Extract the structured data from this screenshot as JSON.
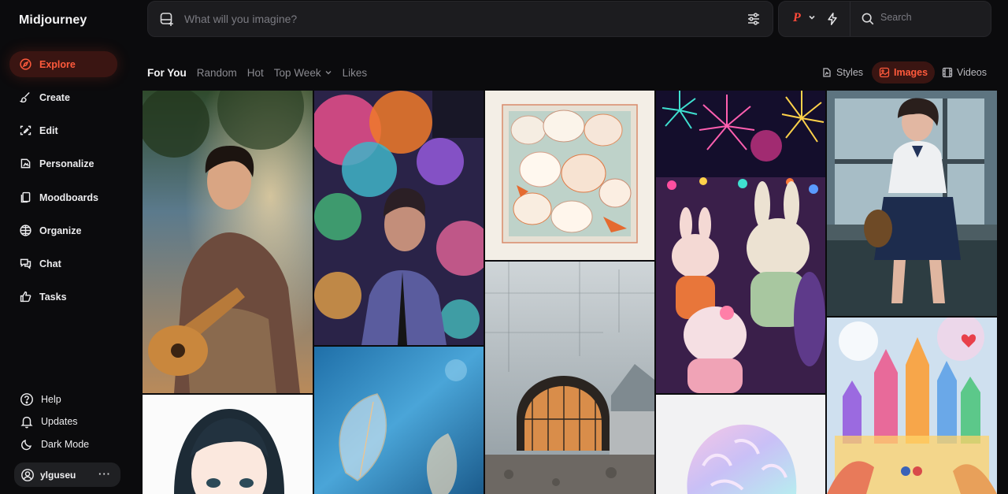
{
  "app": {
    "name": "Midjourney"
  },
  "sidebar": {
    "items": [
      {
        "label": "Explore",
        "icon": "compass-icon",
        "active": true
      },
      {
        "label": "Create",
        "icon": "brush-icon",
        "active": false
      },
      {
        "label": "Edit",
        "icon": "edit-frame-icon",
        "active": false
      },
      {
        "label": "Personalize",
        "icon": "personalize-icon",
        "active": false
      },
      {
        "label": "Moodboards",
        "icon": "moodboard-icon",
        "active": false
      },
      {
        "label": "Organize",
        "icon": "grid-icon",
        "active": false
      },
      {
        "label": "Chat",
        "icon": "chat-icon",
        "active": false
      },
      {
        "label": "Tasks",
        "icon": "thumbs-up-icon",
        "active": false
      }
    ],
    "bottom": [
      {
        "label": "Help",
        "icon": "help-icon"
      },
      {
        "label": "Updates",
        "icon": "bell-icon"
      },
      {
        "label": "Dark Mode",
        "icon": "moon-icon"
      }
    ],
    "user": {
      "name": "ylguseu",
      "more": "···"
    }
  },
  "topbar": {
    "prompt_placeholder": "What will you imagine?",
    "personalize_letter": "P",
    "search_placeholder": "Search"
  },
  "tabs": [
    {
      "label": "For You",
      "active": true
    },
    {
      "label": "Random",
      "active": false
    },
    {
      "label": "Hot",
      "active": false
    },
    {
      "label": "Top Week",
      "active": false,
      "dropdown": true
    },
    {
      "label": "Likes",
      "active": false
    }
  ],
  "view_toggles": [
    {
      "label": "Styles",
      "icon": "styles-icon",
      "active": false
    },
    {
      "label": "Images",
      "icon": "image-icon",
      "active": true
    },
    {
      "label": "Videos",
      "icon": "film-icon",
      "active": false
    }
  ],
  "colors": {
    "accent": "#ff5a3c",
    "accent_bg": "#3a1512",
    "background": "#0b0b0d",
    "surface": "#1c1c1f"
  }
}
